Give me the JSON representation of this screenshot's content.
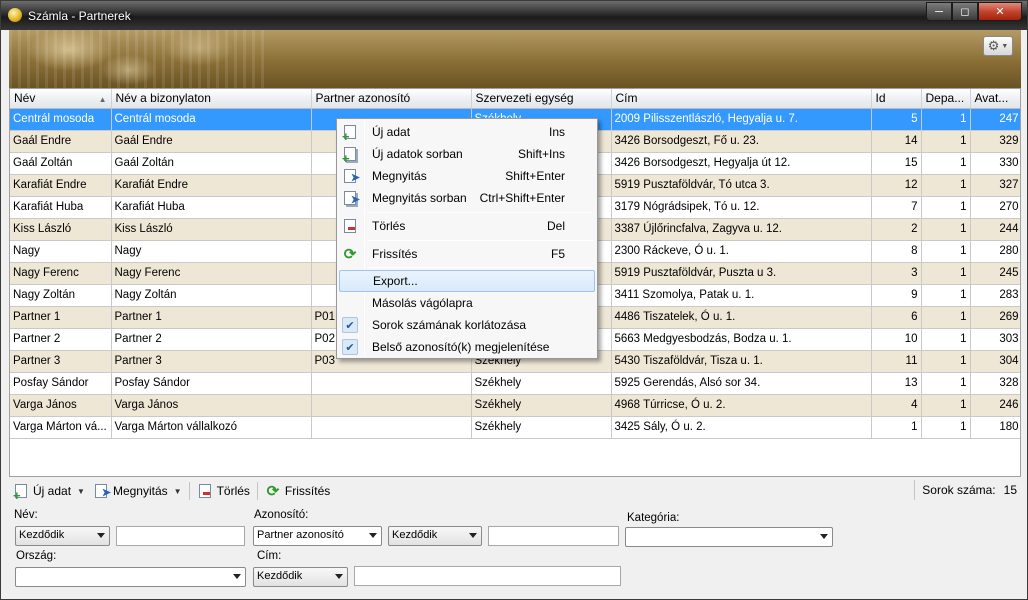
{
  "window": {
    "title": "Számla - Partnerek"
  },
  "grid": {
    "columns": [
      "Név",
      "Név a bizonylaton",
      "Partner azonosító",
      "Szervezeti egység",
      "Cím",
      "Id",
      "Depa...",
      "Avat..."
    ],
    "rows": [
      [
        "Centrál mosoda",
        "Centrál mosoda",
        "",
        "Székhely",
        "2009 Pilisszentlászló, Hegyalja u. 7.",
        "5",
        "1",
        "247"
      ],
      [
        "Gaál Endre",
        "Gaál Endre",
        "",
        "Székhely",
        "3426 Borsodgeszt, Fő u. 23.",
        "14",
        "1",
        "329"
      ],
      [
        "Gaál Zoltán",
        "Gaál Zoltán",
        "",
        "Székhely",
        "3426 Borsodgeszt, Hegyalja út 12.",
        "15",
        "1",
        "330"
      ],
      [
        "Karafiát Endre",
        "Karafiát Endre",
        "",
        "Székhely",
        "5919 Pusztaföldvár, Tó utca 3.",
        "12",
        "1",
        "327"
      ],
      [
        "Karafiát Huba",
        "Karafiát Huba",
        "",
        "Székhely",
        "3179 Nógrádsipek, Tó u. 12.",
        "7",
        "1",
        "270"
      ],
      [
        "Kiss László",
        "Kiss László",
        "",
        "Székhely",
        "3387 Újlőrincfalva, Zagyva u. 12.",
        "2",
        "1",
        "244"
      ],
      [
        "Nagy",
        "Nagy",
        "",
        "Székhely",
        "2300 Ráckeve, Ó u. 1.",
        "8",
        "1",
        "280"
      ],
      [
        "Nagy Ferenc",
        "Nagy Ferenc",
        "",
        "Székhely",
        "5919 Pusztaföldvár, Puszta u 3.",
        "3",
        "1",
        "245"
      ],
      [
        "Nagy Zoltán",
        "Nagy Zoltán",
        "",
        "Székhely",
        "3411 Szomolya, Patak u. 1.",
        "9",
        "1",
        "283"
      ],
      [
        "Partner 1",
        "Partner 1",
        "P01",
        "Székhely",
        "4486 Tiszatelek, Ó u. 1.",
        "6",
        "1",
        "269"
      ],
      [
        "Partner 2",
        "Partner 2",
        "P02",
        "Székhely",
        "5663 Medgyesbodzás, Bodza u. 1.",
        "10",
        "1",
        "303"
      ],
      [
        "Partner 3",
        "Partner 3",
        "P03",
        "Székhely",
        "5430 Tiszaföldvár, Tisza u. 1.",
        "11",
        "1",
        "304"
      ],
      [
        "Posfay Sándor",
        "Posfay Sándor",
        "",
        "Székhely",
        "5925 Gerendás, Alsó sor 34.",
        "13",
        "1",
        "328"
      ],
      [
        "Varga János",
        "Varga János",
        "",
        "Székhely",
        "4968 Túrricse, Ó u. 2.",
        "4",
        "1",
        "246"
      ],
      [
        "Varga Márton vá...",
        "Varga Márton vállalkozó",
        "",
        "Székhely",
        "3425 Sály, Ó u. 2.",
        "1",
        "1",
        "180"
      ]
    ]
  },
  "context_menu": {
    "new": {
      "label": "Új adat",
      "shortcut": "Ins"
    },
    "new_series": {
      "label": "Új adatok sorban",
      "shortcut": "Shift+Ins"
    },
    "open": {
      "label": "Megnyitás",
      "shortcut": "Shift+Enter"
    },
    "open_series": {
      "label": "Megnyitás sorban",
      "shortcut": "Ctrl+Shift+Enter"
    },
    "delete": {
      "label": "Törlés",
      "shortcut": "Del"
    },
    "refresh": {
      "label": "Frissítés",
      "shortcut": "F5"
    },
    "export": {
      "label": "Export..."
    },
    "copy": {
      "label": "Másolás vágólapra"
    },
    "limit_rows": {
      "label": "Sorok számának korlátozása",
      "checked": true
    },
    "show_internal_id": {
      "label": "Belső azonosító(k) megjelenítése",
      "checked": true
    }
  },
  "toolbar": {
    "new_label": "Új adat",
    "open_label": "Megnyitás",
    "delete_label": "Törlés",
    "refresh_label": "Frissítés",
    "row_count_label": "Sorok száma:",
    "row_count_value": "15"
  },
  "filters": {
    "name_label": "Név:",
    "name_mode": "Kezdődik",
    "name_value": "",
    "id_label": "Azonosító:",
    "id_field": "Partner azonosító",
    "id_mode": "Kezdődik",
    "id_value": "",
    "category_label": "Kategória:",
    "category_value": "",
    "country_label": "Ország:",
    "country_value": "",
    "address_label": "Cím:",
    "address_mode": "Kezdődik",
    "address_value": ""
  },
  "colors": {
    "selection": "#3399ff",
    "alt_row": "#efe7d6",
    "banner": "#8a6e36"
  }
}
